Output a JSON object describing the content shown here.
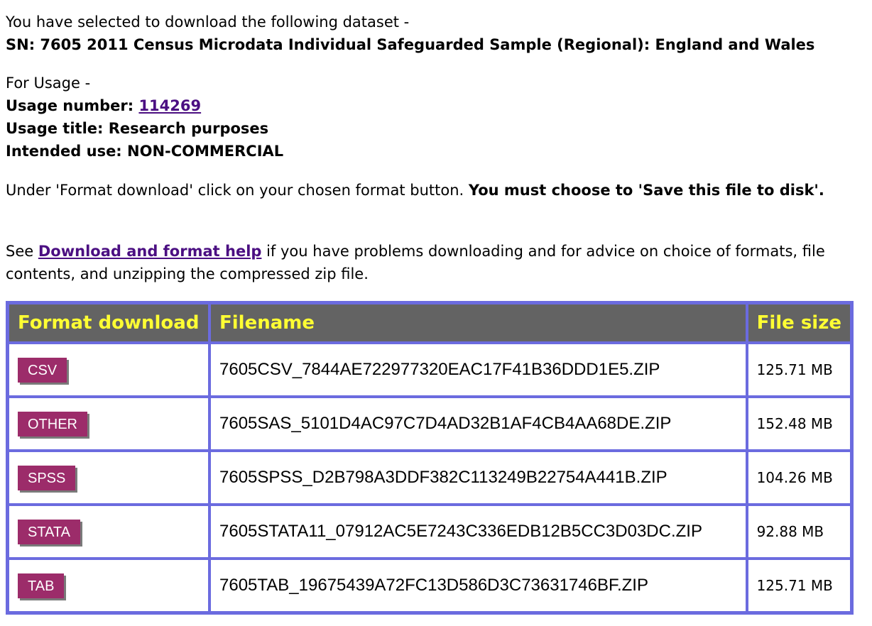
{
  "intro": {
    "line1": "You have selected to download the following dataset -",
    "dataset": "SN: 7605 2011 Census Microdata Individual Safeguarded Sample (Regional): England and Wales"
  },
  "usage": {
    "heading": "For Usage -",
    "number_label": "Usage number: ",
    "number_value": "114269",
    "title_label": "Usage title: Research purposes",
    "intended_label": "Intended use: NON-COMMERCIAL"
  },
  "instructions": {
    "plain": "Under 'Format download' click on your chosen format button. ",
    "bold": "You must choose to 'Save this file to disk'."
  },
  "help": {
    "before": "See ",
    "link": "Download and format help",
    "after": " if you have problems downloading and for advice on choice of formats, file contents, and unzipping the compressed zip file."
  },
  "table": {
    "headers": [
      "Format download",
      "Filename",
      "File size"
    ],
    "rows": [
      {
        "format": "CSV",
        "filename": "7605CSV_7844AE722977320EAC17F41B36DDD1E5.ZIP",
        "size": "125.71 MB"
      },
      {
        "format": "OTHER",
        "filename": "7605SAS_5101D4AC97C7D4AD32B1AF4CB4AA68DE.ZIP",
        "size": "152.48 MB"
      },
      {
        "format": "SPSS",
        "filename": "7605SPSS_D2B798A3DDF382C113249B22754A441B.ZIP",
        "size": "104.26 MB"
      },
      {
        "format": "STATA",
        "filename": "7605STATA11_07912AC5E7243C336EDB12B5CC3D03DC.ZIP",
        "size": "92.88 MB"
      },
      {
        "format": "TAB",
        "filename": "7605TAB_19675439A72FC13D586D3C73631746BF.ZIP",
        "size": "125.71 MB"
      }
    ]
  },
  "colors": {
    "header_bg": "#636363",
    "header_text": "#ffff33",
    "table_border": "#6b6bdf",
    "button_bg": "#9c2c6a",
    "link": "#4b0f82"
  }
}
